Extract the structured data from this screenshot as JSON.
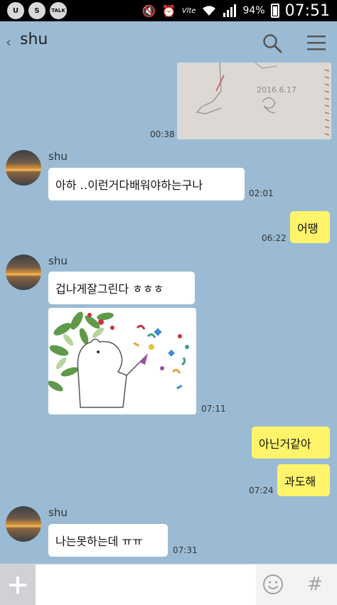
{
  "status_bar": {
    "apps": [
      "U",
      "S",
      "TALK"
    ],
    "network": "Vlte",
    "battery": "94%",
    "time": "07:51"
  },
  "header": {
    "back_icon": "chevron-left-icon",
    "title": "shu",
    "search_icon": "search-icon",
    "menu_icon": "hamburger-menu-icon"
  },
  "messages": [
    {
      "type": "image",
      "direction": "out",
      "time": "00:38"
    },
    {
      "type": "text",
      "direction": "in",
      "sender": "shu",
      "text": "아하 ‥이런거다배워야하는구나",
      "time": "02:01"
    },
    {
      "type": "text",
      "direction": "out",
      "text": "어땡",
      "time": "06:22"
    },
    {
      "type": "text",
      "direction": "in",
      "sender": "shu",
      "text": "겁나게잘그린다 ㅎㅎㅎ"
    },
    {
      "type": "sticker",
      "direction": "in",
      "time": "07:11"
    },
    {
      "type": "text",
      "direction": "out",
      "text": "아닌거같아"
    },
    {
      "type": "text",
      "direction": "out",
      "text": "과도해",
      "time": "07:24"
    },
    {
      "type": "text",
      "direction": "in",
      "sender": "shu",
      "text": "나는못하는데 ㅠㅠ",
      "time": "07:31"
    }
  ],
  "footer": {
    "plus_icon": "plus-icon",
    "input_placeholder": "",
    "emoticon_icon": "emoticon-icon",
    "hash_label": "#"
  },
  "colors": {
    "background": "#9bbbd4",
    "outgoing_bubble": "#fff46a",
    "incoming_bubble": "#ffffff"
  }
}
